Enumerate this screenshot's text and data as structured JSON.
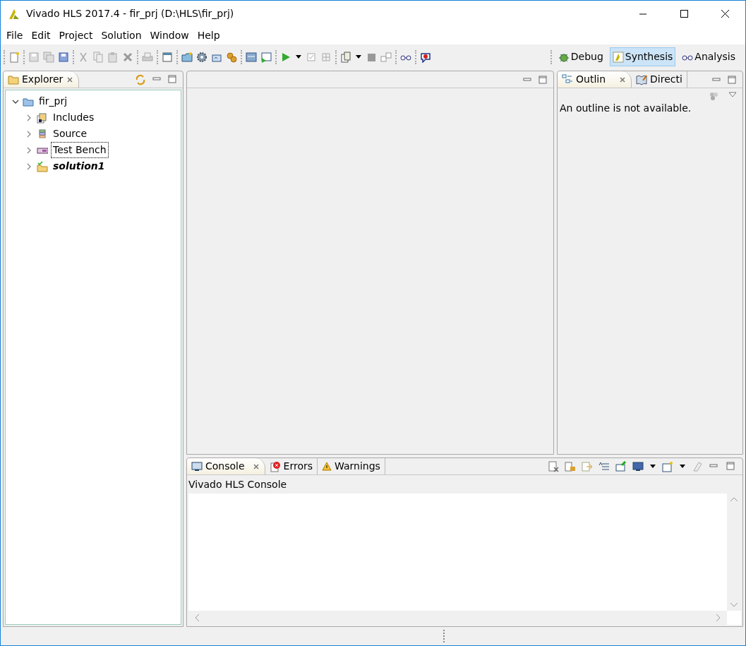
{
  "window": {
    "title": "Vivado HLS 2017.4 - fir_prj (D:\\HLS\\fir_prj)"
  },
  "menu": [
    "File",
    "Edit",
    "Project",
    "Solution",
    "Window",
    "Help"
  ],
  "perspectives": [
    {
      "label": "Debug",
      "selected": false
    },
    {
      "label": "Synthesis",
      "selected": true
    },
    {
      "label": "Analysis",
      "selected": false
    }
  ],
  "explorer": {
    "tab": "Explorer",
    "tree": [
      {
        "label": "fir_prj",
        "expanded": true,
        "active": false,
        "focused": false,
        "children": [
          {
            "label": "Includes",
            "expanded": false,
            "active": false,
            "focused": false
          },
          {
            "label": "Source",
            "expanded": false,
            "active": false,
            "focused": false
          },
          {
            "label": "Test Bench",
            "expanded": false,
            "active": false,
            "focused": true
          },
          {
            "label": "solution1",
            "expanded": false,
            "active": true,
            "focused": false
          }
        ]
      }
    ]
  },
  "outline": {
    "tabs": [
      {
        "label": "Outlin",
        "selected": true
      },
      {
        "label": "Directi",
        "selected": false
      }
    ],
    "message": "An outline is not available."
  },
  "console": {
    "tabs": [
      {
        "label": "Console",
        "selected": true
      },
      {
        "label": "Errors",
        "selected": false
      },
      {
        "label": "Warnings",
        "selected": false
      }
    ],
    "title": "Vivado HLS Console"
  }
}
